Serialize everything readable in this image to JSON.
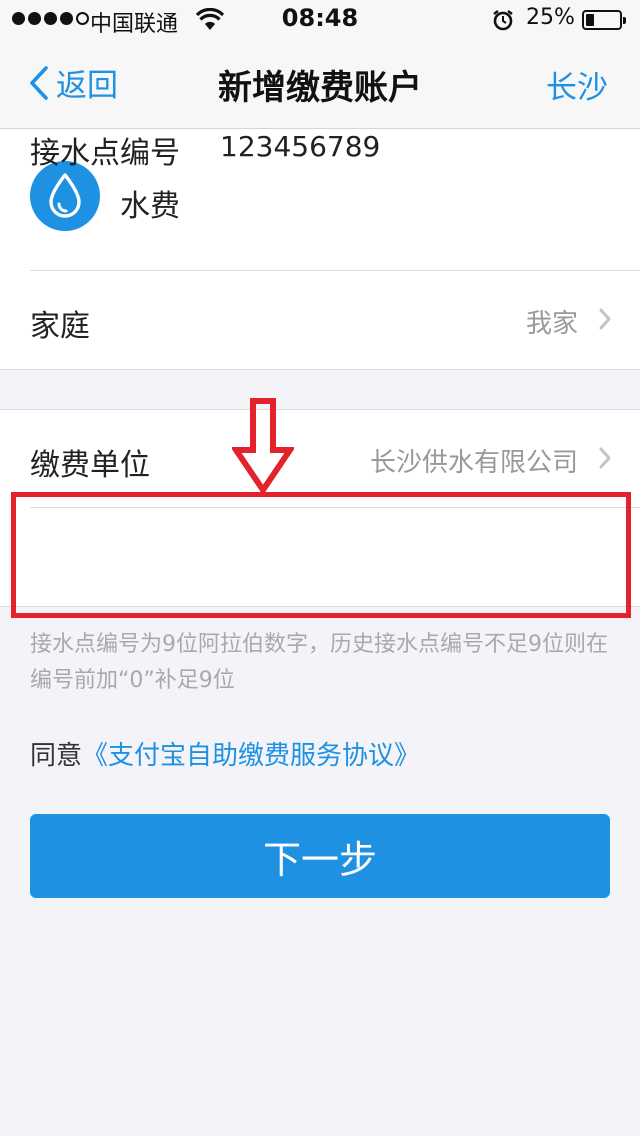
{
  "status_bar": {
    "carrier": "中国联通",
    "time": "08:48",
    "battery_percent_text": "25%",
    "battery_level": 0.25
  },
  "nav": {
    "back_label": "返回",
    "title": "新增缴费账户",
    "city": "长沙"
  },
  "bill": {
    "name": "水费",
    "icon": "water-drop-icon"
  },
  "rows": {
    "group_label": "家庭",
    "group_value": "我家",
    "company_label": "缴费单位",
    "company_value": "长沙供水有限公司",
    "account_label": "接水点编号",
    "account_value": "123456789"
  },
  "hint": "接水点编号为9位阿拉伯数字，历史接水点编号不足9位则在编号前加“0”补足9位",
  "agreement": {
    "prefix": "同意",
    "link": "《支付宝自助缴费服务协议》"
  },
  "next_button": "下一步",
  "colors": {
    "accent": "#1e91e3",
    "annotation_red": "#e3222b"
  }
}
